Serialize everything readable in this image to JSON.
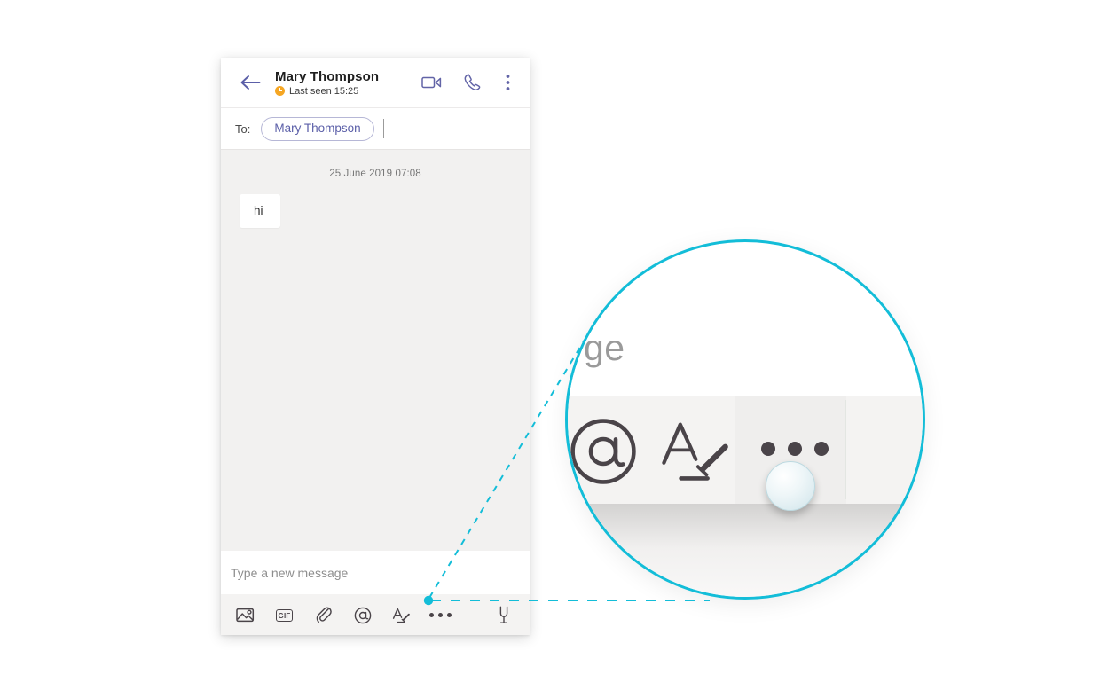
{
  "app": {
    "accent_purple": "#6264a7",
    "accent_cyan": "#13bdd8",
    "presence_orange": "#f5a623",
    "chat_bg": "#f2f1f0"
  },
  "header": {
    "back_label": "Back",
    "contact_name": "Mary Thompson",
    "presence_status": "Last seen 15:25",
    "presence_icon": "clock-away-icon",
    "icons": [
      {
        "name": "video-call-icon",
        "label": "Video call"
      },
      {
        "name": "audio-call-icon",
        "label": "Audio call"
      },
      {
        "name": "more-options-icon",
        "label": "More options"
      }
    ]
  },
  "recipients": {
    "to_label": "To:",
    "pill_name": "Mary Thompson"
  },
  "conversation": {
    "timestamp": "25 June 2019 07:08",
    "messages": [
      {
        "text": "hi",
        "from": "me"
      }
    ]
  },
  "composer": {
    "placeholder": "Type a new message",
    "value": ""
  },
  "action_bar": {
    "buttons": [
      {
        "name": "image-icon",
        "label": "Image"
      },
      {
        "name": "gif-icon",
        "label": "GIF"
      },
      {
        "name": "attach-icon",
        "label": "Attach file"
      },
      {
        "name": "mention-icon",
        "label": "Mention"
      },
      {
        "name": "format-icon",
        "label": "Format text"
      },
      {
        "name": "more-icon",
        "label": "More options"
      },
      {
        "name": "microphone-icon",
        "label": "Voice message"
      }
    ],
    "gif_text": "GIF"
  },
  "magnifier": {
    "visible_text": "ge",
    "focused_button": "more-icon",
    "focused_button_label": "More options",
    "cursor": "touch-pointer"
  }
}
